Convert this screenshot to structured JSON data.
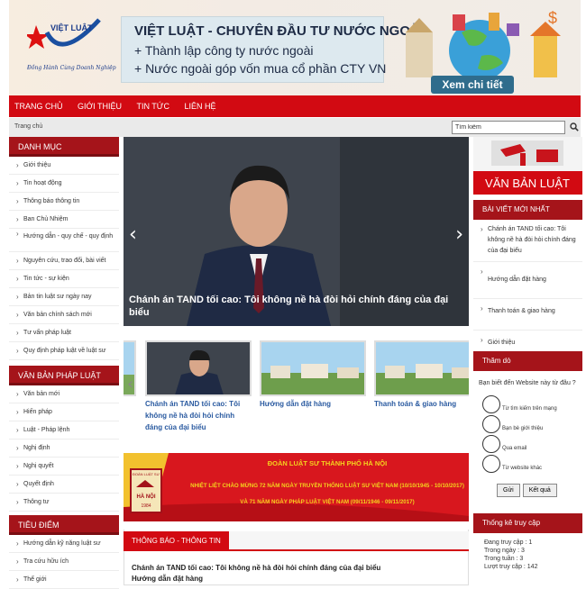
{
  "header": {
    "logo_text": "VIỆT LUẬT",
    "logo_slogan": "Đồng Hành Cùng Doanh Nghiệp",
    "title": "VIỆT LUẬT - CHUYÊN ĐẦU TƯ NƯỚC NGOÀI",
    "line1": "+ Thành lập công ty nước ngoài",
    "line2": "+ Nước ngoài góp vốn mua cổ phần CTY VN",
    "detail_button": "Xem chi tiết"
  },
  "nav": [
    "TRANG CHỦ",
    "GIỚI THIỆU",
    "TIN TỨC",
    "LIÊN HỆ"
  ],
  "breadcrumb": "Trang chủ",
  "search": {
    "value": "Tìm kiếm"
  },
  "left": {
    "menu_title": "DANH MỤC",
    "menu": [
      "Giới thiệu",
      "Tin hoạt động",
      "Thông báo thông tin",
      "Ban Chủ Nhiệm",
      "Hướng dẫn - quy chế - quy định",
      "Nguyên cứu, trao đổi, bài viết",
      "Tin tức - sự kiện",
      "Bản tin luật sư ngày nay",
      "Văn bản chính sách mới",
      "Tư vấn pháp luật",
      "Quy định pháp luật về luật sư"
    ],
    "law_title": "VĂN BẢN PHÁP LUẬT",
    "law": [
      "Văn bản mới",
      "Hiến pháp",
      "Luật - Pháp lệnh",
      "Nghị định",
      "Nghị quyết",
      "Quyết định",
      "Thông tư"
    ],
    "focus_title": "TIÊU ĐIỂM",
    "focus": [
      "Hướng dẫn kỹ năng luật sư",
      "Tra cứu hữu ích",
      "Thể giới"
    ]
  },
  "slider": {
    "caption": "Chánh án TAND tối cao: Tôi không nề hà đòi hỏi chính đáng của đại biểu"
  },
  "thumbs": [
    {
      "title": "Chánh án TAND tối cao: Tôi không nề hà đòi hỏi chính đáng của đại biểu"
    },
    {
      "title": "Hướng dẫn đặt hàng"
    },
    {
      "title": "Thanh toán & giao hàng"
    }
  ],
  "promo": {
    "org": "ĐOÀN LUẬT SƯ THÀNH PHỐ HÀ NỘI",
    "line1": "NHIỆT LIỆT CHÀO MỪNG 72 NĂM NGÀY TRUYỀN THỐNG LUẬT SƯ VIỆT NAM (10/10/1945 - 10/10/2017)",
    "line2": "VÀ 71 NĂM NGÀY PHÁP LUẬT VIỆT NAM (09/11/1946 - 09/11/2017)",
    "badge_top": "ĐOÀN LUẬT SƯ",
    "badge_mid": "HÀ NỘI",
    "badge_year": "1984"
  },
  "notice": {
    "title": "THÔNG BÁO - THÔNG TIN",
    "items": [
      "Chánh án TAND tối cao: Tôi không nề hà đòi hỏi chính đáng của đại biểu",
      "Hướng dẫn đặt hàng"
    ]
  },
  "right": {
    "vbl_title": "VĂN BẢN LUẬT",
    "new_title": "BÀI VIẾT MỚI NHẤT",
    "new": [
      "Chánh án TAND tối cao: Tôi không nề hà đòi hỏi chính đáng của đại biểu",
      "Hướng dẫn đặt hàng",
      "Thanh toán & giao hàng",
      "Giới thiệu"
    ],
    "poll_title": "Thăm dò",
    "poll_question": "Bạn biết đến Website này từ đâu ?",
    "poll_options": [
      "Từ tìm kiếm trên mạng",
      "Bạn bè giới thiệu",
      "Qua email",
      "Từ website khác"
    ],
    "vote": "Gửi",
    "result": "Kết quả",
    "stats_title": "Thống kê truy cập",
    "stats": [
      "Đang truy cập : 1",
      "Trong ngày : 3",
      "Trong tuần : 3",
      "Lượt truy cập : 142"
    ]
  }
}
